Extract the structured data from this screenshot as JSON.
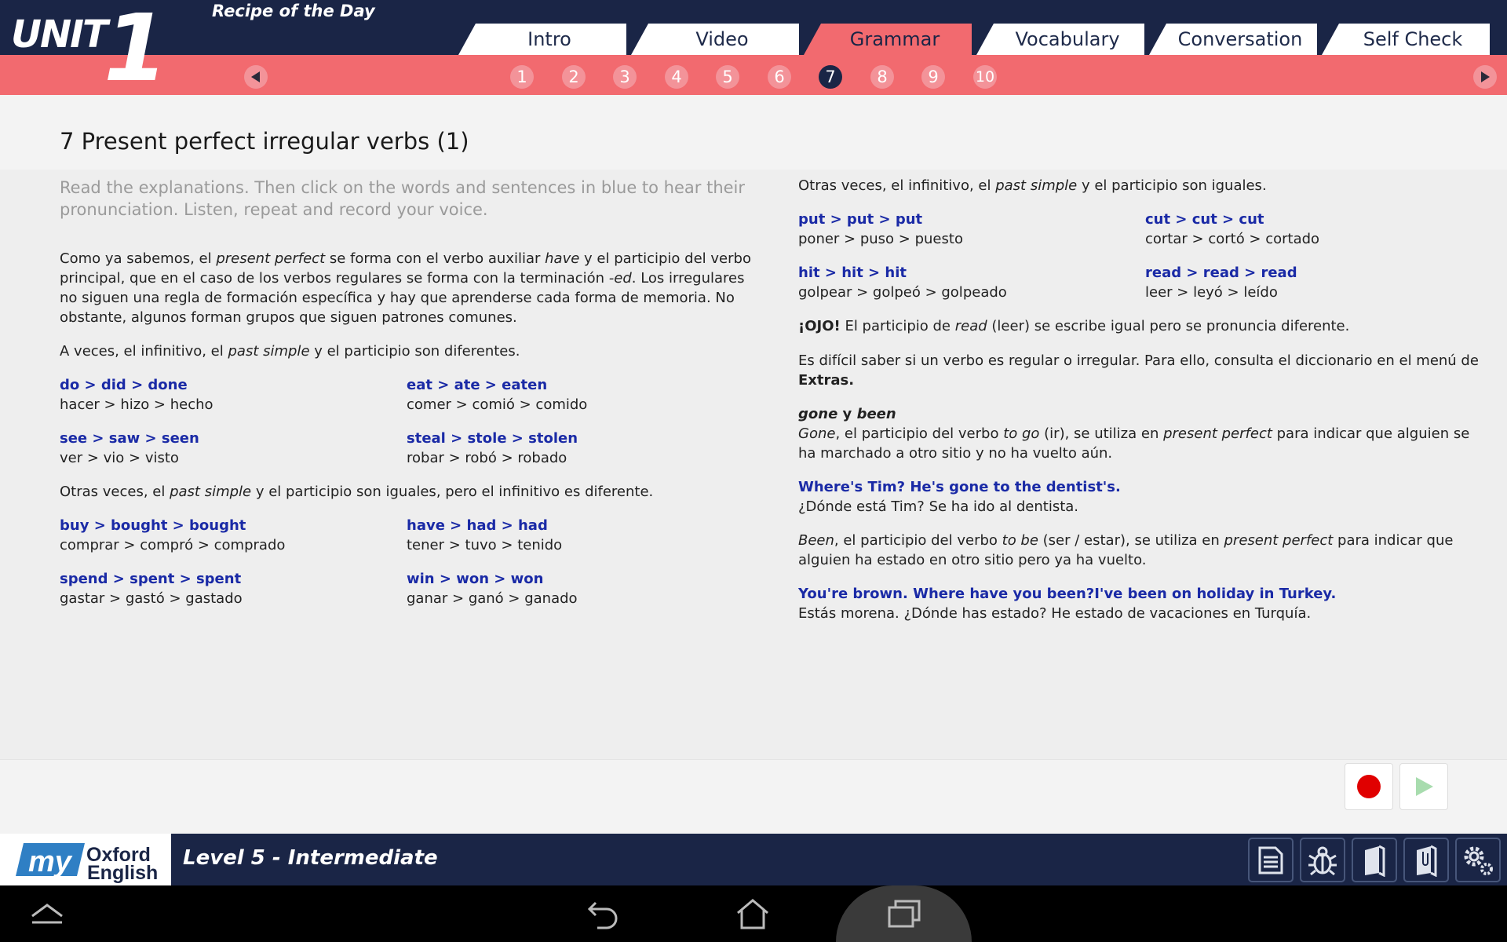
{
  "header": {
    "unit_word": "UNIT",
    "unit_number": "1",
    "recipe": "Recipe of the Day",
    "tabs": [
      "Intro",
      "Video",
      "Grammar",
      "Vocabulary",
      "Conversation",
      "Self Check"
    ],
    "active_tab": "Grammar",
    "pages": [
      "1",
      "2",
      "3",
      "4",
      "5",
      "6",
      "7",
      "8",
      "9",
      "10"
    ],
    "active_page": "7"
  },
  "title": "7 Present perfect irregular verbs (1)",
  "left": {
    "instructions": "Read the explanations. Then click on the words and sentences in blue to hear their pronunciation. Listen, repeat and record your voice.",
    "p1": {
      "a": "Como ya sabemos, el ",
      "b": "present perfect",
      "c": " se forma con el verbo auxiliar ",
      "d": "have",
      "e": " y el participio del verbo principal, que en el caso de los verbos regulares se forma con la terminación ",
      "f": "-ed",
      "g": ". Los irregulares no siguen una regla de formación específica y hay que aprenderse cada forma de memoria. No obstante, algunos forman grupos que siguen patrones comunes."
    },
    "p2": {
      "a": "A veces, el infinitivo, el ",
      "b": "past simple",
      "c": " y el participio son diferentes."
    },
    "group1": [
      {
        "en": "do > did > done",
        "es": "hacer > hizo > hecho"
      },
      {
        "en": "eat > ate > eaten",
        "es": "comer > comió > comido"
      },
      {
        "en": "see > saw > seen",
        "es": "ver > vio > visto"
      },
      {
        "en": "steal > stole > stolen",
        "es": "robar > robó > robado"
      }
    ],
    "p3": {
      "a": "Otras veces, el ",
      "b": "past simple",
      "c": " y el participio son iguales, pero el infinitivo es diferente."
    },
    "group2": [
      {
        "en": "buy > bought > bought",
        "es": "comprar > compró > comprado"
      },
      {
        "en": "have > had > had",
        "es": "tener > tuvo > tenido"
      },
      {
        "en": "spend > spent > spent",
        "es": "gastar > gastó > gastado"
      },
      {
        "en": "win > won  > won",
        "es": "ganar > ganó > ganado"
      }
    ]
  },
  "right": {
    "p1": {
      "a": "Otras veces, el infinitivo, el ",
      "b": "past simple",
      "c": " y el participio son iguales."
    },
    "group3": [
      {
        "en": "put > put > put",
        "es": "poner > puso > puesto"
      },
      {
        "en": "cut > cut > cut",
        "es": "cortar > cortó > cortado"
      },
      {
        "en": "hit  > hit  > hit",
        "es": "golpear > golpeó > golpeado"
      },
      {
        "en": "read > read > read",
        "es": "leer > leyó > leído"
      }
    ],
    "ojo": {
      "a": "¡OJO!",
      "b": " El participio de ",
      "c": "read",
      "d": " (leer) se escribe igual pero se pronuncia diferente."
    },
    "p2": {
      "a": "Es difícil saber si un verbo es regular o irregular. Para ello, consulta el diccionario en el menú de ",
      "b": "Extras."
    },
    "gone_heading": {
      "a": "gone",
      "b": " y ",
      "c": "been"
    },
    "gone": {
      "a": "Gone",
      "b": ", el participio del verbo ",
      "c": "to go",
      "d": " (ir), se utiliza en ",
      "e": "present perfect",
      "f": " para indicar que alguien se ha marchado a otro sitio y no ha vuelto aún."
    },
    "ex1_en": "Where's Tim?  He's gone to the dentist's.",
    "ex1_es": "¿Dónde está Tim?  Se ha ido al dentista.",
    "been": {
      "a": "Been",
      "b": ", el participio del verbo ",
      "c": "to be",
      "d": " (ser / estar), se utiliza en ",
      "e": "present perfect",
      "f": " para indicar que alguien ha estado en otro sitio pero ya ha vuelto."
    },
    "ex2_en": "You're brown. Where have you been?I've been on holiday in Turkey.",
    "ex2_es": "Estás morena. ¿Dónde has estado?  He estado de vacaciones en Turquía."
  },
  "footer": {
    "logo_my": "my",
    "logo_oxford": "Oxford",
    "logo_english": "English",
    "level": "Level 5 - Intermediate"
  },
  "colors": {
    "navy": "#1a2546",
    "pink": "#f26a6f",
    "blue_text": "#1a2aa6",
    "record_red": "#e00000"
  }
}
